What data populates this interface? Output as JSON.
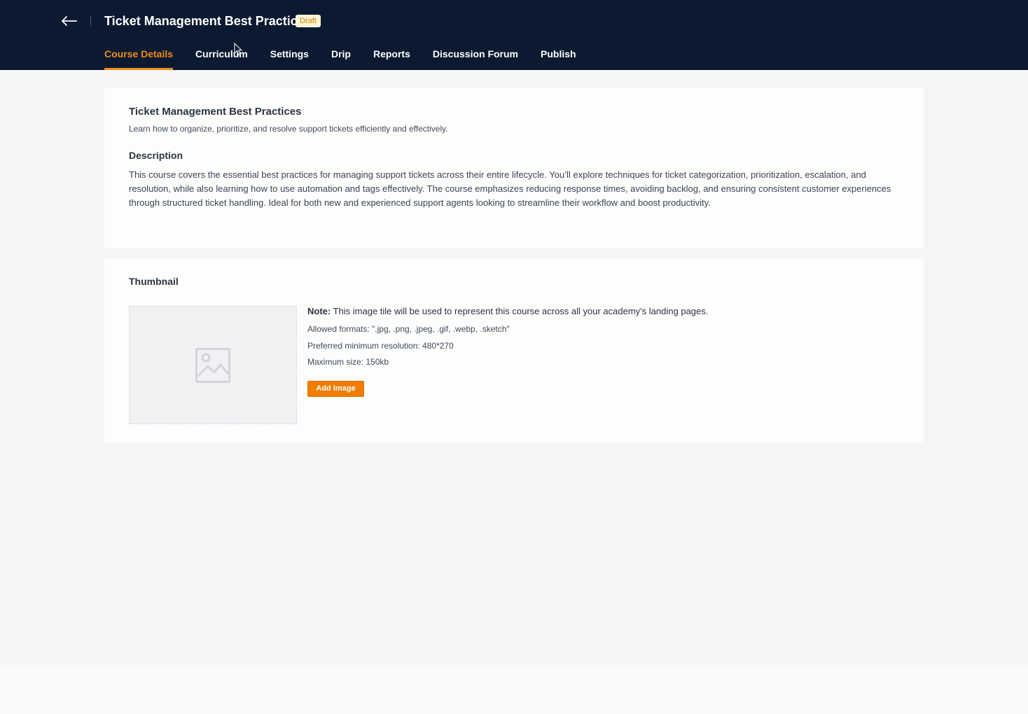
{
  "header": {
    "back_icon": "arrow-left-icon",
    "title": "Ticket Management Best Practices",
    "status_badge": "Draft",
    "colors": {
      "background": "#0b1a30",
      "accent": "#f08a1c",
      "badge_bg": "#fdf4d8",
      "badge_text": "#c98a00"
    }
  },
  "tabs": [
    {
      "label": "Course Details",
      "active": true
    },
    {
      "label": "Curriculum",
      "active": false
    },
    {
      "label": "Settings",
      "active": false
    },
    {
      "label": "Drip",
      "active": false
    },
    {
      "label": "Reports",
      "active": false
    },
    {
      "label": "Discussion Forum",
      "active": false
    },
    {
      "label": "Publish",
      "active": false
    }
  ],
  "details": {
    "title": "Ticket Management Best Practices",
    "subtitle": "Learn how to organize, prioritize, and resolve support tickets efficiently and effectively.",
    "description_heading": "Description",
    "description": "This course covers the essential best practices for managing support tickets across their entire lifecycle. You’ll explore techniques for ticket categorization, prioritization, escalation, and resolution, while also learning how to use automation and tags effectively. The course emphasizes reducing response times, avoiding backlog, and ensuring consistent customer experiences through structured ticket handling. Ideal for both new and experienced support agents looking to streamline their workflow and boost productivity."
  },
  "thumbnail": {
    "heading": "Thumbnail",
    "placeholder_icon": "image-placeholder-icon",
    "note_label": "Note:",
    "note_text": " This image tile will be used to represent this course across all your academy's landing pages.",
    "allowed_formats": "Allowed formats: \".jpg, .png, .jpeg, .gif, .webp, .sketch\"",
    "min_resolution": "Preferred minimum resolution: 480*270",
    "max_size": "Maximum size: 150kb",
    "add_button": "Add Image",
    "button_color": "#f07c00"
  }
}
